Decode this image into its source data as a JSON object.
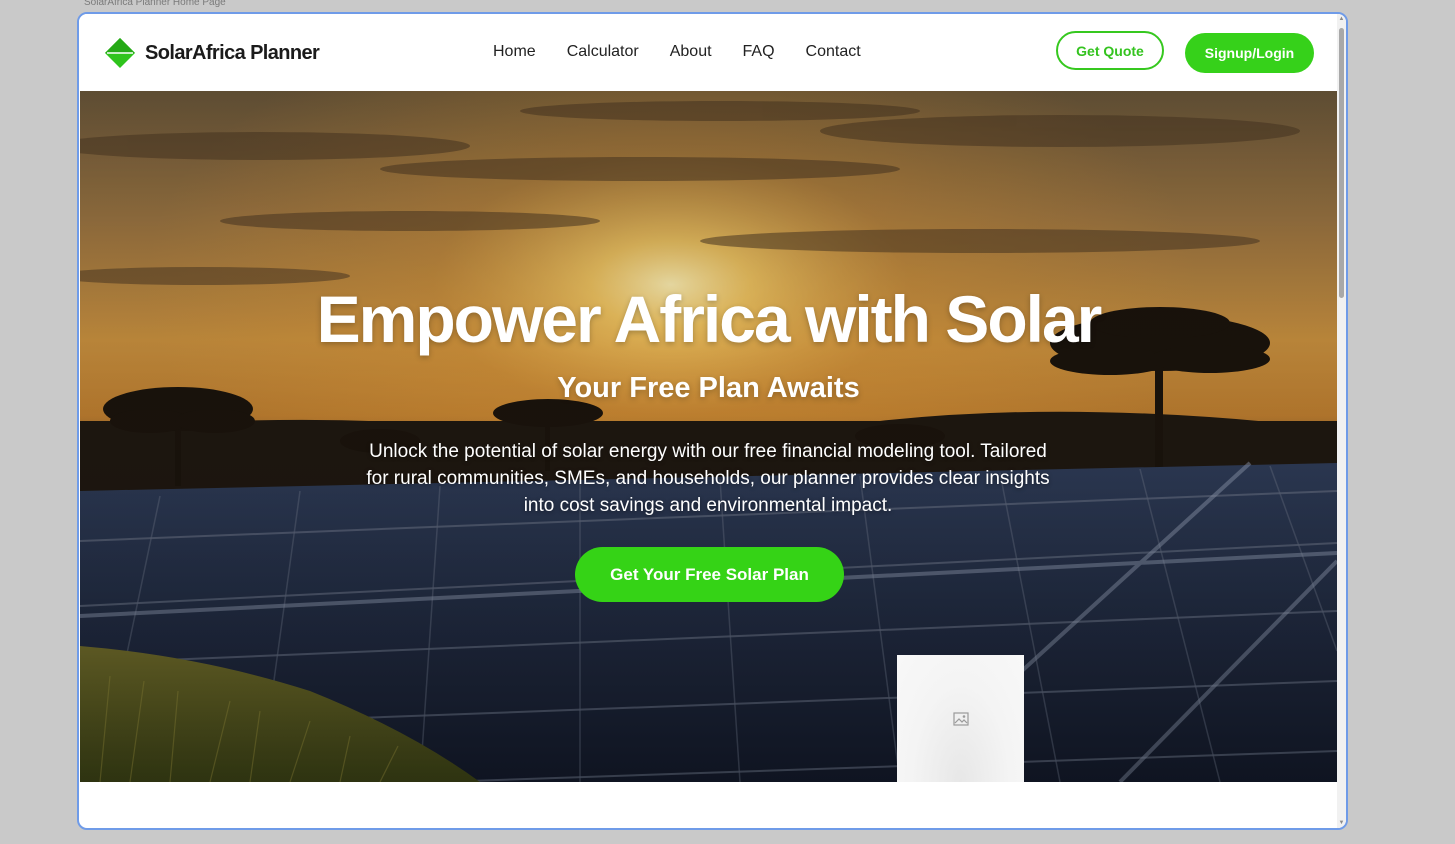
{
  "window": {
    "caption": "SolarAfrica Planner Home Page"
  },
  "brand": {
    "name": "SolarAfrica Planner",
    "logo_icon": "green-diamond-logo-icon"
  },
  "nav": {
    "links": [
      {
        "label": "Home"
      },
      {
        "label": "Calculator"
      },
      {
        "label": "About"
      },
      {
        "label": "FAQ"
      },
      {
        "label": "Contact"
      }
    ],
    "quote_button": "Get Quote",
    "signup_button": "Signup/Login"
  },
  "hero": {
    "title": "Empower Africa with Solar",
    "subtitle": "Your Free Plan Awaits",
    "description": "Unlock the potential of solar energy with our free financial modeling tool. Tailored for rural communities, SMEs, and households, our planner provides clear insights into cost savings and environmental impact.",
    "cta_button": "Get Your Free Solar Plan",
    "image_placeholder_icon": "broken-image-icon"
  },
  "colors": {
    "accent_green": "#36d11a",
    "frame_border": "#6f9be8",
    "page_background": "#c9c9c9"
  }
}
